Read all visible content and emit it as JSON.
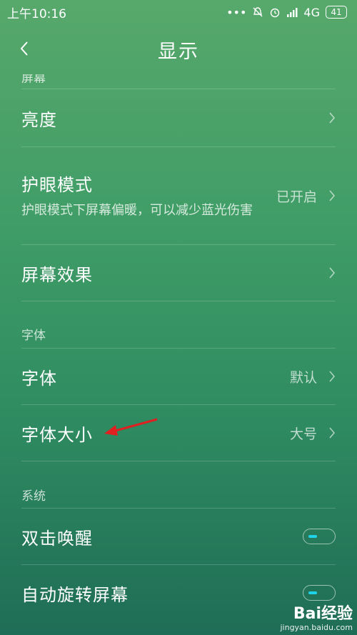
{
  "statusbar": {
    "time": "上午10:16",
    "network": "4G",
    "battery": "41"
  },
  "header": {
    "title": "显示"
  },
  "sections": {
    "screen": "屏幕",
    "font": "字体",
    "system": "系统"
  },
  "rows": {
    "brightness": {
      "label": "亮度"
    },
    "eye_care": {
      "label": "护眼模式",
      "sub": "护眼模式下屏幕偏暖，可以减少蓝光伤害",
      "value": "已开启"
    },
    "screen_effect": {
      "label": "屏幕效果"
    },
    "font": {
      "label": "字体",
      "value": "默认"
    },
    "font_size": {
      "label": "字体大小",
      "value": "大号"
    },
    "double_tap_wake": {
      "label": "双击唤醒"
    },
    "auto_rotate": {
      "label": "自动旋转屏幕"
    }
  },
  "watermark": {
    "brand": "Bai经验",
    "url": "jingyan.baidu.com"
  },
  "colors": {
    "toggle_knob": "#1fd3e8",
    "annotation_arrow": "#e02020"
  }
}
